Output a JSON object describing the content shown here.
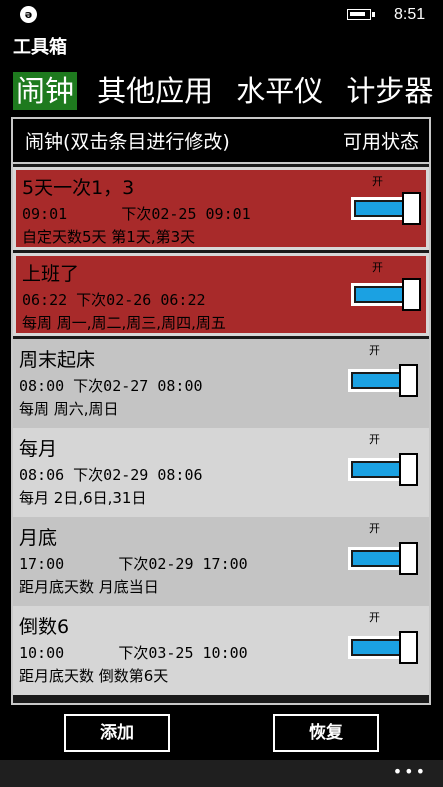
{
  "status_bar": {
    "app_icon_glyph": "ə",
    "time": "8:51"
  },
  "app": {
    "title": "工具箱"
  },
  "pivot": {
    "tabs": [
      {
        "label": "闹钟",
        "active": true
      },
      {
        "label": "其他应用",
        "active": false
      },
      {
        "label": "水平仪",
        "active": false
      },
      {
        "label": "计步器",
        "active": false
      }
    ]
  },
  "panel": {
    "title": "闹钟(双击条目进行修改)",
    "status_header": "可用状态"
  },
  "alarms": [
    {
      "name": "5天一次1，3",
      "times": "09:01      下次02-25 09:01",
      "repeat": "自定天数5天 第1天,第3天",
      "on_label": "开",
      "enabled": true,
      "selected": true
    },
    {
      "name": "上班了",
      "times": "06:22 下次02-26 06:22",
      "repeat": "每周  周一,周二,周三,周四,周五",
      "on_label": "开",
      "enabled": true,
      "selected": true
    },
    {
      "name": "周末起床",
      "times": "08:00 下次02-27 08:00",
      "repeat": "每周  周六,周日",
      "on_label": "开",
      "enabled": true,
      "selected": false
    },
    {
      "name": "每月",
      "times": "08:06 下次02-29 08:06",
      "repeat": "每月  2日,6日,31日",
      "on_label": "开",
      "enabled": true,
      "selected": false
    },
    {
      "name": "月底",
      "times": "17:00      下次02-29 17:00",
      "repeat": "距月底天数 月底当日",
      "on_label": "开",
      "enabled": true,
      "selected": false
    },
    {
      "name": "倒数6",
      "times": "10:00      下次03-25 10:00",
      "repeat": "距月底天数 倒数第6天",
      "on_label": "开",
      "enabled": true,
      "selected": false
    }
  ],
  "buttons": {
    "add": "添加",
    "restore": "恢复"
  },
  "app_bar": {
    "more": "•••"
  },
  "colors": {
    "selected_row": "#a82a2a",
    "toggle_fill": "#1ba1e2",
    "active_tab": "#1e7a1e"
  }
}
